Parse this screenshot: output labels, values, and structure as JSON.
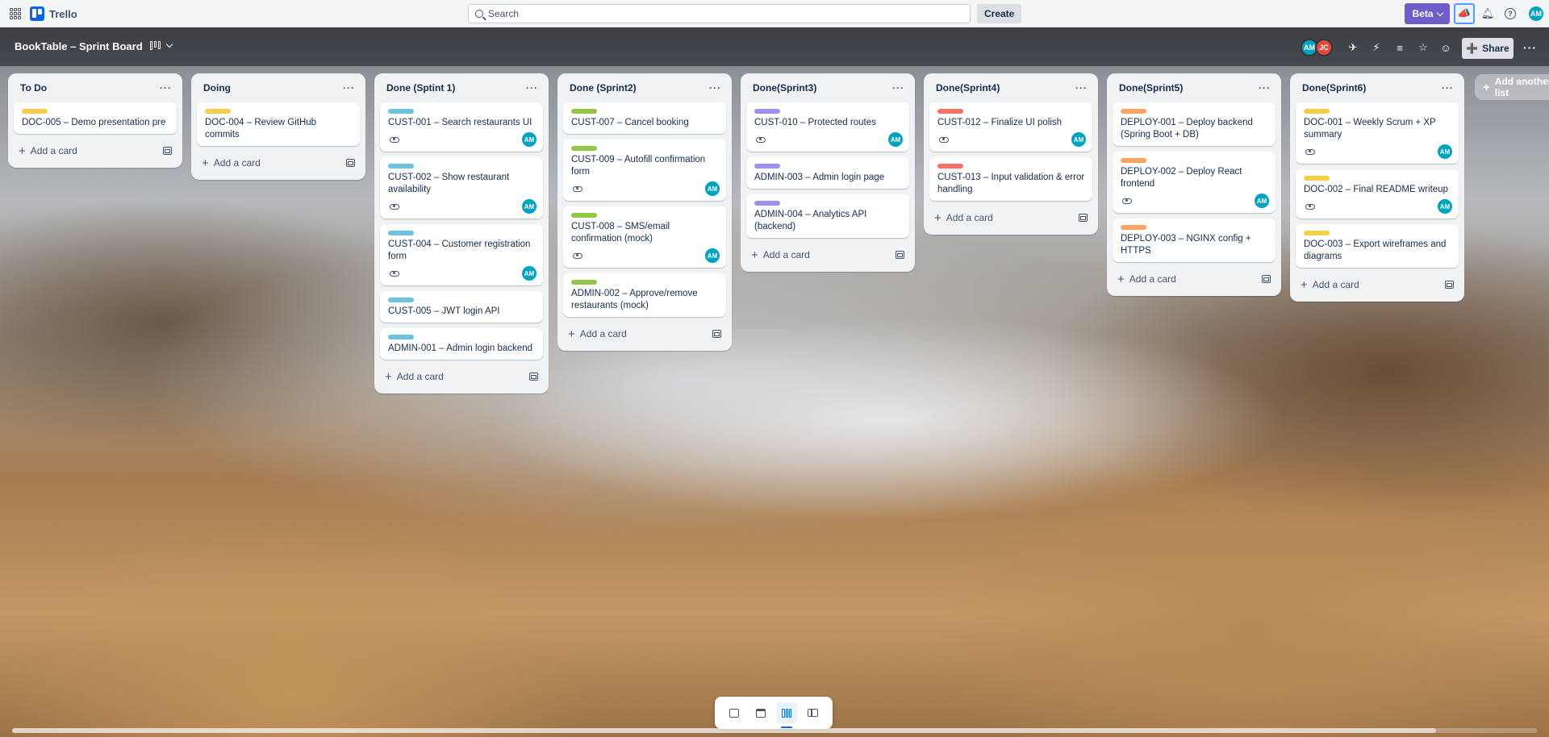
{
  "app": {
    "name": "Trello"
  },
  "topbar": {
    "search_placeholder": "Search",
    "create_label": "Create",
    "beta_label": "Beta",
    "user_initials": "AM"
  },
  "board": {
    "title": "BookTable – Sprint Board",
    "members": [
      {
        "initials": "AM",
        "color": "#00a3bf"
      },
      {
        "initials": "JC",
        "color": "#e2483d"
      }
    ],
    "share_label": "Share",
    "add_list_label": "Add another list"
  },
  "label_colors": {
    "yellow": "#f5cd47",
    "blue": "#6cc3e0",
    "green": "#94c748",
    "purple": "#9f8fef",
    "red": "#f87168",
    "orange": "#fea362"
  },
  "add_card_label": "Add a card",
  "lists": [
    {
      "title": "To Do",
      "cards": [
        {
          "label": "yellow",
          "title": "DOC-005 – Demo presentation pre",
          "watch": false,
          "member": ""
        }
      ]
    },
    {
      "title": "Doing",
      "cards": [
        {
          "label": "yellow",
          "title": "DOC-004 – Review GitHub commits",
          "watch": false,
          "member": ""
        }
      ]
    },
    {
      "title": "Done (Sptint 1)",
      "cards": [
        {
          "label": "blue",
          "title": "CUST-001 – Search restaurants UI",
          "watch": true,
          "member": "AM"
        },
        {
          "label": "blue",
          "title": "CUST-002 – Show restaurant availability",
          "watch": true,
          "member": "AM"
        },
        {
          "label": "blue",
          "title": "CUST-004 – Customer registration form",
          "watch": true,
          "member": "AM"
        },
        {
          "label": "blue",
          "title": "CUST-005 – JWT login API",
          "watch": false,
          "member": ""
        },
        {
          "label": "blue",
          "title": "ADMIN-001 – Admin login backend",
          "watch": false,
          "member": ""
        }
      ]
    },
    {
      "title": "Done (Sprint2)",
      "cards": [
        {
          "label": "green",
          "title": "CUST-007 – Cancel booking",
          "watch": false,
          "member": ""
        },
        {
          "label": "green",
          "title": "CUST-009 – Autofill confirmation form",
          "watch": true,
          "member": "AM"
        },
        {
          "label": "green",
          "title": "CUST-008 – SMS/email confirmation (mock)",
          "watch": true,
          "member": "AM"
        },
        {
          "label": "green",
          "title": "ADMIN-002 – Approve/remove restaurants (mock)",
          "watch": false,
          "member": ""
        }
      ]
    },
    {
      "title": "Done(Sprint3)",
      "cards": [
        {
          "label": "purple",
          "title": "CUST-010 – Protected routes",
          "watch": true,
          "member": "AM"
        },
        {
          "label": "purple",
          "title": "ADMIN-003 – Admin login page",
          "watch": false,
          "member": ""
        },
        {
          "label": "purple",
          "title": "ADMIN-004 – Analytics API (backend)",
          "watch": false,
          "member": ""
        }
      ]
    },
    {
      "title": "Done(Sprint4)",
      "cards": [
        {
          "label": "red",
          "title": "CUST-012 – Finalize UI polish",
          "watch": true,
          "member": "AM"
        },
        {
          "label": "red",
          "title": "CUST-013 – Input validation & error handling",
          "watch": false,
          "member": ""
        }
      ]
    },
    {
      "title": "Done(Sprint5)",
      "cards": [
        {
          "label": "orange",
          "title": "DEPLOY-001 – Deploy backend (Spring Boot + DB)",
          "watch": false,
          "member": ""
        },
        {
          "label": "orange",
          "title": "DEPLOY-002 – Deploy React frontend",
          "watch": true,
          "member": "AM"
        },
        {
          "label": "orange",
          "title": "DEPLOY-003 – NGINX config + HTTPS",
          "watch": false,
          "member": ""
        }
      ]
    },
    {
      "title": "Done(Sprint6)",
      "cards": [
        {
          "label": "yellow",
          "title": "DOC-001 – Weekly Scrum + XP summary",
          "watch": true,
          "member": "AM"
        },
        {
          "label": "yellow",
          "title": "DOC-002 – Final README writeup",
          "watch": true,
          "member": "AM"
        },
        {
          "label": "yellow",
          "title": "DOC-003 – Export wireframes and diagrams",
          "watch": false,
          "member": ""
        }
      ]
    }
  ]
}
